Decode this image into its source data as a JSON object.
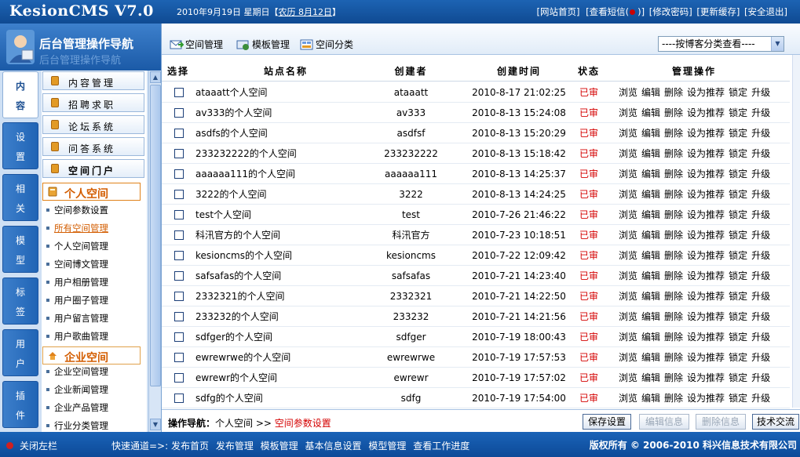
{
  "header": {
    "logo": "KesionCMS V7.0",
    "date_prefix": "2010年9月19日 星期日【",
    "lunar_date": "农历 8月12日",
    "date_suffix": "】",
    "links": [
      "[网站首页]",
      "[查看短信(",
      ")]",
      "[修改密码]",
      "[更新缓存]",
      "[安全退出]"
    ]
  },
  "sidebar": {
    "title": "后台管理操作导航",
    "title_ghost": "后台管理操作导航",
    "tabs": [
      "内容",
      "设置",
      "相关",
      "模型",
      "标签",
      "用户",
      "插件"
    ],
    "modules": [
      "内容管理",
      "招聘求职",
      "论坛系统",
      "问答系统",
      "空间门户"
    ],
    "group1": {
      "label": "个人空间",
      "items": [
        "空间参数设置",
        "所有空间管理",
        "个人空间管理",
        "空间博文管理",
        "用户相册管理",
        "用户圈子管理",
        "用户留言管理",
        "用户歌曲管理"
      ]
    },
    "group2": {
      "label": "企业空间",
      "items": [
        "企业空间管理",
        "企业新闻管理",
        "企业产品管理",
        "行业分类管理"
      ]
    }
  },
  "toolbar": {
    "space_manage": "空间管理",
    "template_manage": "模板管理",
    "space_category": "空间分类",
    "blog_filter": "----按博客分类查看----"
  },
  "table": {
    "headers": {
      "select": "选择",
      "name": "站点名称",
      "creator": "创建者",
      "time": "创建时间",
      "state": "状态",
      "ops": "管理操作"
    },
    "ops": [
      "浏览",
      "编辑",
      "删除",
      "设为推荐",
      "锁定",
      "升级"
    ],
    "rows": [
      {
        "name": "ataaatt个人空间",
        "creator": "ataaatt",
        "time": "2010-8-17 21:02:25",
        "state": "已审"
      },
      {
        "name": "av333的个人空间",
        "creator": "av333",
        "time": "2010-8-13 15:24:08",
        "state": "已审"
      },
      {
        "name": "asdfs的个人空间",
        "creator": "asdfsf",
        "time": "2010-8-13 15:20:29",
        "state": "已审"
      },
      {
        "name": "233232222的个人空间",
        "creator": "233232222",
        "time": "2010-8-13 15:18:42",
        "state": "已审"
      },
      {
        "name": "aaaaaa111的个人空间",
        "creator": "aaaaaa111",
        "time": "2010-8-13 14:25:37",
        "state": "已审"
      },
      {
        "name": "3222的个人空间",
        "creator": "3222",
        "time": "2010-8-13 14:24:25",
        "state": "已审"
      },
      {
        "name": "test个人空间",
        "creator": "test",
        "time": "2010-7-26 21:46:22",
        "state": "已审"
      },
      {
        "name": "科汛官方的个人空间",
        "creator": "科汛官方",
        "time": "2010-7-23 10:18:51",
        "state": "已审"
      },
      {
        "name": "kesioncms的个人空间",
        "creator": "kesioncms",
        "time": "2010-7-22 12:09:42",
        "state": "已审"
      },
      {
        "name": "safsafas的个人空间",
        "creator": "safsafas",
        "time": "2010-7-21 14:23:40",
        "state": "已审"
      },
      {
        "name": "2332321的个人空间",
        "creator": "2332321",
        "time": "2010-7-21 14:22:50",
        "state": "已审"
      },
      {
        "name": "233232的个人空间",
        "creator": "233232",
        "time": "2010-7-21 14:21:56",
        "state": "已审"
      },
      {
        "name": "sdfger的个人空间",
        "creator": "sdfger",
        "time": "2010-7-19 18:00:43",
        "state": "已审"
      },
      {
        "name": "ewrewrwe的个人空间",
        "creator": "ewrewrwe",
        "time": "2010-7-19 17:57:53",
        "state": "已审"
      },
      {
        "name": "ewrewr的个人空间",
        "creator": "ewrewr",
        "time": "2010-7-19 17:57:02",
        "state": "已审"
      },
      {
        "name": "sdfg的个人空间",
        "creator": "sdfg",
        "time": "2010-7-19 17:54:00",
        "state": "已审"
      }
    ]
  },
  "footer": {
    "nav_label": "操作导航：",
    "nav_parent": "个人空间",
    "nav_sep": ">>",
    "nav_current": "空间参数设置",
    "buttons": [
      "保存设置",
      "编辑信息",
      "删除信息",
      "技术交流"
    ]
  },
  "statusbar": {
    "close_left": "关闭左栏",
    "quick_label": "快速通道=>:",
    "quick_links": [
      "发布首页",
      "发布管理",
      "模板管理",
      "基本信息设置",
      "模型管理",
      "查看工作进度"
    ],
    "copyright": "版权所有 © 2006-2010 科兴信息技术有限公司"
  },
  "colors": {
    "accent": "#1b5aa7",
    "state": "#d40000",
    "selected_menu": "#d35d00"
  }
}
